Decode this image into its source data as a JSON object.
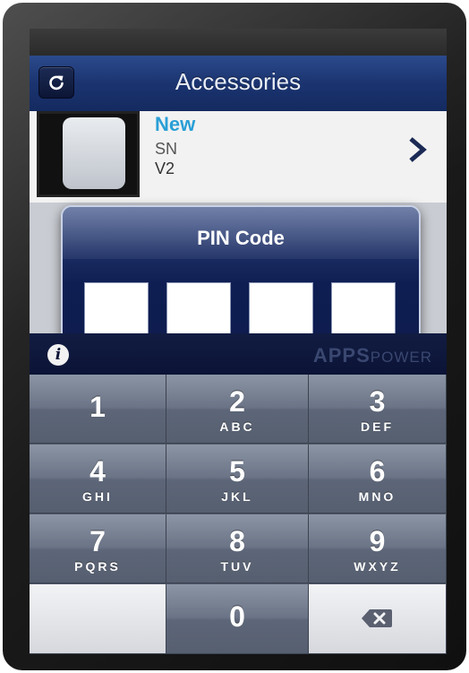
{
  "nav": {
    "title": "Accessories",
    "refresh_icon": "refresh-icon"
  },
  "list_row": {
    "title": "New",
    "sn_label": "SN",
    "version": "V2"
  },
  "dialog": {
    "title": "PIN Code",
    "pin_slots": 4
  },
  "infobar": {
    "info_glyph": "i",
    "brand_main": "APPS",
    "brand_sub": "POWER"
  },
  "keypad": {
    "keys": [
      {
        "digit": "1",
        "letters": ""
      },
      {
        "digit": "2",
        "letters": "ABC"
      },
      {
        "digit": "3",
        "letters": "DEF"
      },
      {
        "digit": "4",
        "letters": "GHI"
      },
      {
        "digit": "5",
        "letters": "JKL"
      },
      {
        "digit": "6",
        "letters": "MNO"
      },
      {
        "digit": "7",
        "letters": "PQRS"
      },
      {
        "digit": "8",
        "letters": "TUV"
      },
      {
        "digit": "9",
        "letters": "WXYZ"
      },
      {
        "digit": "0",
        "letters": ""
      }
    ],
    "delete_icon": "backspace-icon"
  },
  "colors": {
    "nav_blue": "#1b3470",
    "dialog_blue": "#0f1e52",
    "key_gray": "#6b7486",
    "accent_cyan": "#2a9fd6"
  }
}
